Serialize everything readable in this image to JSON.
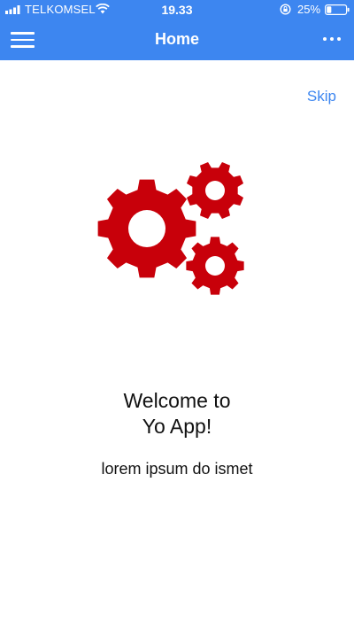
{
  "status_bar": {
    "carrier": "TELKOMSEL",
    "time": "19.33",
    "battery_percent": "25%",
    "battery_level": 0.25
  },
  "header": {
    "title": "Home"
  },
  "onboarding": {
    "skip_label": "Skip",
    "title_line1": "Welcome to",
    "title_line2": "Yo App!",
    "subtitle": "lorem ipsum do ismet"
  },
  "colors": {
    "header_bg": "#3d86f0",
    "gear": "#c8000a",
    "link": "#3d86f0"
  },
  "icons": {
    "menu": "hamburger-icon",
    "more": "more-dots-icon",
    "illustration": "gears-icon"
  }
}
